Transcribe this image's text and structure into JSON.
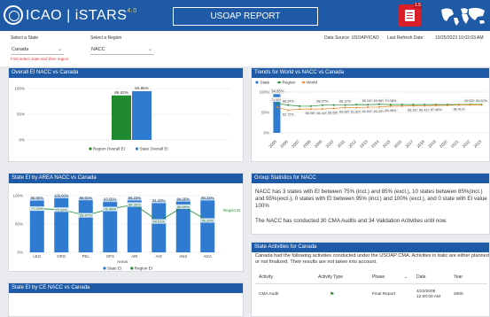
{
  "header": {
    "brand": "ICAO",
    "product": "iSTARS",
    "version": "4.0",
    "report_title": "USOAP REPORT",
    "pdf_badge": "1.5"
  },
  "filters": {
    "state_label": "Select a State",
    "state_value": "Canada",
    "region_label": "Select a Region",
    "region_value": "NACC",
    "hint": "First select state and then region",
    "data_source_label": "Data Source: USOAP/ICAO",
    "last_refresh_label": "Last Refresh Date:",
    "last_refresh_value": "10/25/2023 10:02:03 AM"
  },
  "panels": {
    "overall": {
      "title": "Overall EI NACC vs Canada"
    },
    "trends": {
      "title": "Trends for World vs NACC vs Canada"
    },
    "area": {
      "title": "State EI by AREA NACC vs Canada"
    },
    "group": {
      "title": "Group Statistics for NACC"
    },
    "activities": {
      "title": "State Activities for Canada"
    },
    "ce": {
      "title": "State EI by CE NACC vs Canada"
    }
  },
  "group_stats": {
    "p1": "NACC has 3 states with EI between 75% (incl.) and 85% (excl.), 10 states between 85%(incl.) and 95%(excl.), 0 states with EI between 95% (incl.) and 100% (excl.), and 0 state with EI value 100%",
    "p2": "The NACC has conducted 30 CMA Audits and 34 Validation Activities until now."
  },
  "activities": {
    "intro": "Canada had the following activities conducted under the USOAP CMA. Activities in italic are either planned or not finalized. Their results are not taken into account.",
    "columns": [
      "Activity",
      "Activity Type",
      "Phase",
      "Date",
      "Year"
    ],
    "rows": [
      {
        "activity": "CMA Audit",
        "phase": "Final Report",
        "date": "4/23/2005",
        "time": "12:00:00 AM",
        "year": "2005"
      }
    ]
  },
  "chart_data": [
    {
      "type": "bar",
      "title": "Overall EI NACC vs Canada",
      "categories": [
        ""
      ],
      "series": [
        {
          "name": "Region Overall EI",
          "values": [
            86.62
          ],
          "labels": [
            "86.62%"
          ],
          "color": "#1f8a2e"
        },
        {
          "name": "State Overall EI",
          "values": [
            94.85
          ],
          "labels": [
            "94.85%"
          ],
          "color": "#2e7bd1"
        }
      ],
      "ylim": [
        0,
        100
      ],
      "ytick_labels": [
        "0%",
        "50%",
        "100%"
      ],
      "legend": "bottom"
    },
    {
      "type": "line",
      "title": "Trends for World vs NACC vs Canada",
      "x": [
        "2005",
        "2006",
        "2007",
        "2008",
        "2009",
        "2010",
        "2011",
        "2012",
        "2013",
        "2014",
        "2015",
        "2016",
        "2017",
        "2018",
        "2019",
        "2020",
        "2021",
        "2022",
        "2023"
      ],
      "series": [
        {
          "name": "State",
          "type": "bar",
          "values": [
            94.85
          ],
          "labels": [
            "94.85%"
          ],
          "color": "#2e7bd1"
        },
        {
          "name": "Region",
          "values": [
            71.92,
            68.24,
            65.45,
            65.38,
            68.07,
            68.12,
            68.12,
            69.24,
            69.06,
            70.08,
            69.23,
            69.22,
            69.22,
            69.22,
            69.22,
            69.22,
            69.23,
            69.52,
            69.52
          ],
          "labels": [
            "71.92%",
            "68.24%",
            "",
            "",
            "68.07%",
            "",
            "68.12%",
            "",
            "69.24%",
            "69.06%",
            "70.08%",
            "",
            "",
            "",
            "",
            "",
            "",
            "69.52%",
            "69.52%"
          ],
          "color": "#1f8a2e"
        },
        {
          "name": "World",
          "values": [
            62.72,
            55.77,
            58.08,
            58.44,
            58.63,
            60.08,
            61.62,
            61.63,
            62.94,
            63.24,
            65.46,
            65.52,
            66.31,
            66.41,
            67.46,
            67.49,
            68.41,
            68.5,
            68.5
          ],
          "labels": [
            "",
            "62.72%",
            "",
            "58.08%",
            "56.44%",
            "58.63%",
            "60.08%",
            "61.62%",
            "62.94%",
            "63.24%",
            "65.46%",
            "",
            "66.31%",
            "66.41%",
            "67.46%",
            "",
            "68.41%",
            "",
            ""
          ],
          "color": "#e8862e"
        }
      ],
      "ylim": [
        0,
        100
      ],
      "ytick_labels": [
        "0%",
        "50%",
        "100%"
      ],
      "legend": "top-left"
    },
    {
      "type": "bar",
      "title": "State EI by AREA NACC vs Canada",
      "categories": [
        "LEG",
        "ORG",
        "PEL",
        "OPS",
        "AIR",
        "AIG",
        "ANS",
        "AGA"
      ],
      "xlabel": "Areas",
      "series": [
        {
          "name": "State EI",
          "type": "bar",
          "values": [
            95.9,
            100.0,
            96.61,
            93.55,
            96.23,
            91.43,
            94.25,
            96.23
          ],
          "labels": [
            "95.90%",
            "100.00%",
            "96.61%",
            "93.55%",
            "96.23%",
            "91.43%",
            "94.25%",
            "96.23%"
          ],
          "color": "#2e7bd1"
        },
        {
          "name": "Region EI",
          "type": "line",
          "values": [
            77.23,
            75.33,
            65.47,
            76.48,
            84.39,
            54.51,
            80.69,
            56.29
          ],
          "labels": [
            "77.23%",
            "75.33%",
            "65.47%",
            "76.48%",
            "84.39%",
            "54.51%",
            "80.69%",
            "56.29%"
          ],
          "color": "#1f8a2e"
        }
      ],
      "ylim": [
        0,
        100
      ],
      "ytick_labels": [
        "0%",
        "50%",
        "100%"
      ],
      "right_label": "Region EI",
      "legend": "bottom"
    }
  ]
}
